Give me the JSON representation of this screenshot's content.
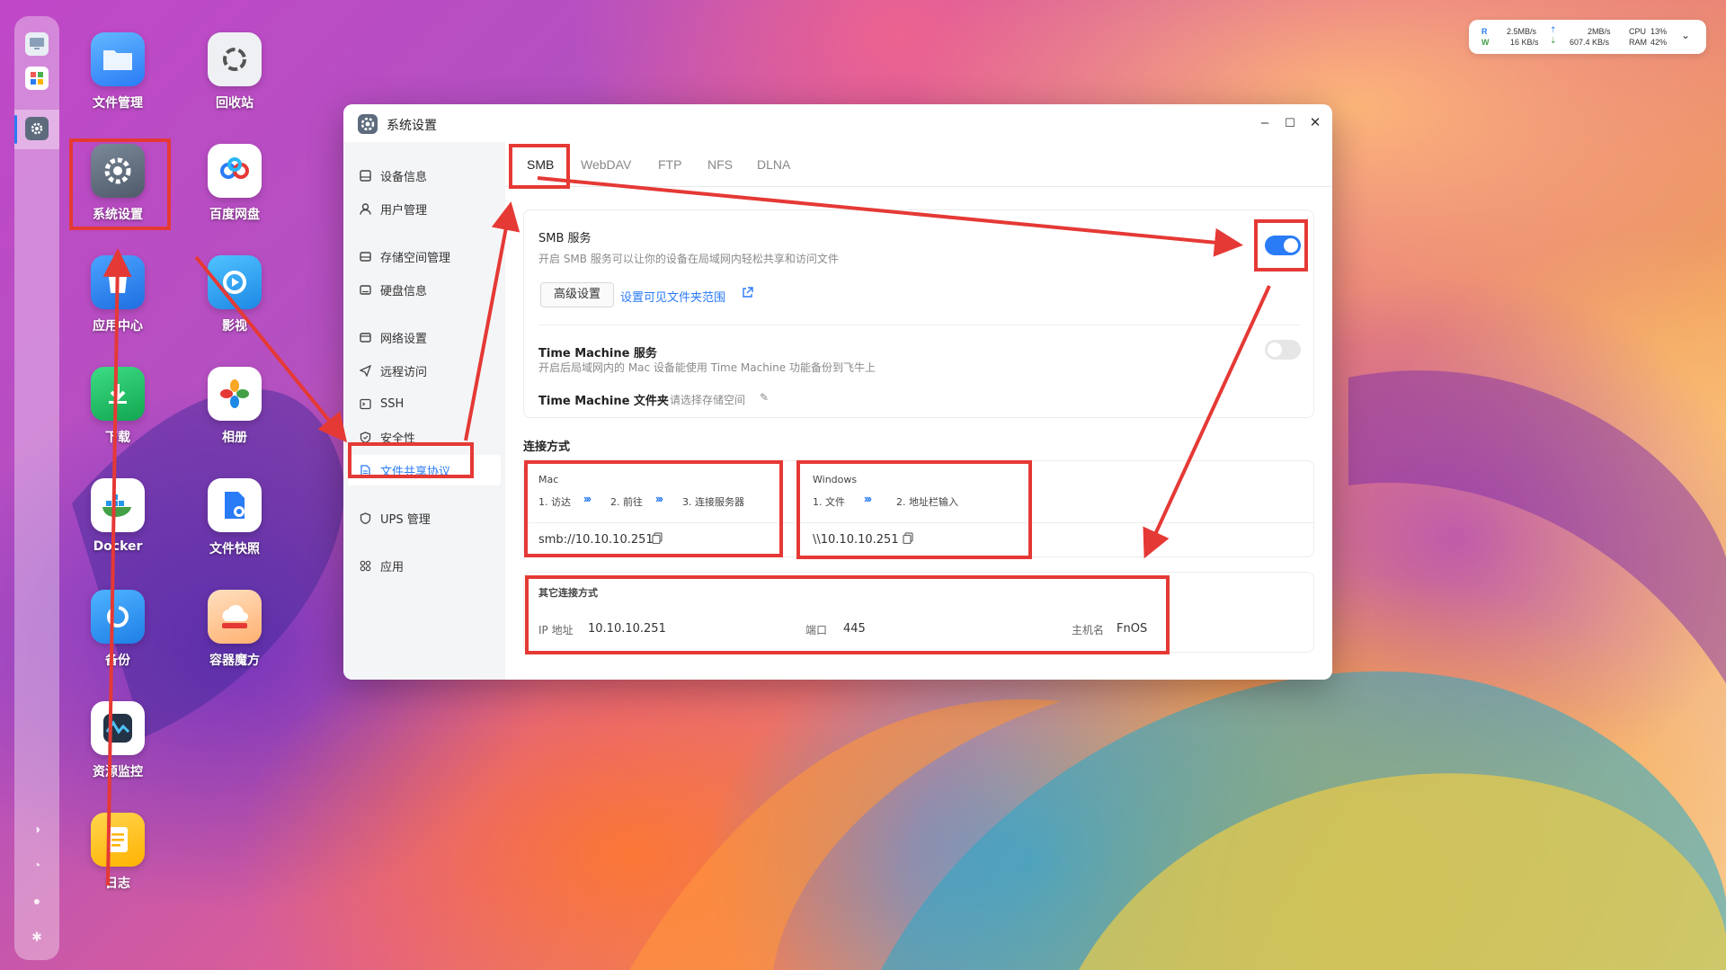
{
  "dock": {
    "items": [
      "monitor-icon",
      "apps-grid-icon",
      "settings-icon"
    ],
    "bottom_icons": [
      "theme-icon",
      "notification-icon",
      "user-icon",
      "gear-icon"
    ]
  },
  "desktop": {
    "icons": [
      {
        "label": "文件管理",
        "icon": "folder-icon"
      },
      {
        "label": "回收站",
        "icon": "recycle-bin-icon"
      },
      {
        "label": "系统设置",
        "icon": "settings-icon"
      },
      {
        "label": "百度网盘",
        "icon": "baidu-cloud-icon"
      },
      {
        "label": "应用中心",
        "icon": "app-store-icon"
      },
      {
        "label": "影视",
        "icon": "video-icon"
      },
      {
        "label": "下载",
        "icon": "download-icon"
      },
      {
        "label": "相册",
        "icon": "photos-icon"
      },
      {
        "label": "Docker",
        "icon": "docker-icon"
      },
      {
        "label": "文件快照",
        "icon": "snapshot-icon"
      },
      {
        "label": "备份",
        "icon": "backup-icon"
      },
      {
        "label": "容器魔方",
        "icon": "container-cube-icon"
      },
      {
        "label": "资源监控",
        "icon": "resource-monitor-icon"
      },
      {
        "label": "日志",
        "icon": "log-icon"
      }
    ]
  },
  "monitor": {
    "r_label": "R",
    "w_label": "W",
    "r_speed": "2.5MB/s",
    "w_speed": "16 KB/s",
    "up_speed": "2MB/s",
    "down_speed": "607.4 KB/s",
    "cpu_label": "CPU",
    "ram_label": "RAM",
    "cpu_value": "13%",
    "ram_value": "42%"
  },
  "window": {
    "title": "系统设置",
    "sidebar": [
      {
        "label": "设备信息",
        "icon": "device-icon"
      },
      {
        "label": "用户管理",
        "icon": "user-icon"
      },
      {
        "label": "存储空间管理",
        "icon": "storage-icon"
      },
      {
        "label": "硬盘信息",
        "icon": "disk-icon"
      },
      {
        "label": "网络设置",
        "icon": "network-icon"
      },
      {
        "label": "远程访问",
        "icon": "remote-icon"
      },
      {
        "label": "SSH",
        "icon": "terminal-icon"
      },
      {
        "label": "安全性",
        "icon": "shield-icon"
      },
      {
        "label": "文件共享协议",
        "icon": "document-icon"
      },
      {
        "label": "UPS 管理",
        "icon": "ups-icon"
      },
      {
        "label": "应用",
        "icon": "apps-icon"
      }
    ],
    "tabs": [
      "SMB",
      "WebDAV",
      "FTP",
      "NFS",
      "DLNA"
    ],
    "smb": {
      "title": "SMB 服务",
      "desc": "开启 SMB 服务可以让你的设备在局域网内轻松共享和访问文件",
      "advanced_btn": "高级设置",
      "visible_folders_link": "设置可见文件夹范围",
      "enabled": true
    },
    "time_machine": {
      "title": "Time Machine 服务",
      "desc": "开启后局域网内的 Mac 设备能使用 Time Machine 功能备份到飞牛上",
      "folder_label": "Time Machine 文件夹",
      "folder_placeholder": "请选择存储空间",
      "enabled": false
    },
    "connection": {
      "heading": "连接方式",
      "mac": {
        "title": "Mac",
        "step1": "1. 访达",
        "step2": "2. 前往",
        "step3": "3. 连接服务器",
        "address": "smb://10.10.10.251"
      },
      "windows": {
        "title": "Windows",
        "step1": "1. 文件",
        "step2": "2. 地址栏输入",
        "address": "\\\\10.10.10.251"
      },
      "other": {
        "title": "其它连接方式",
        "ip_label": "IP 地址",
        "ip_value": "10.10.10.251",
        "port_label": "端口",
        "port_value": "445",
        "host_label": "主机名",
        "host_value": "FnOS"
      }
    }
  },
  "colors": {
    "accent": "#2a7bf6",
    "annotation": "#e53935",
    "toggle_off": "#e6e6e6"
  }
}
